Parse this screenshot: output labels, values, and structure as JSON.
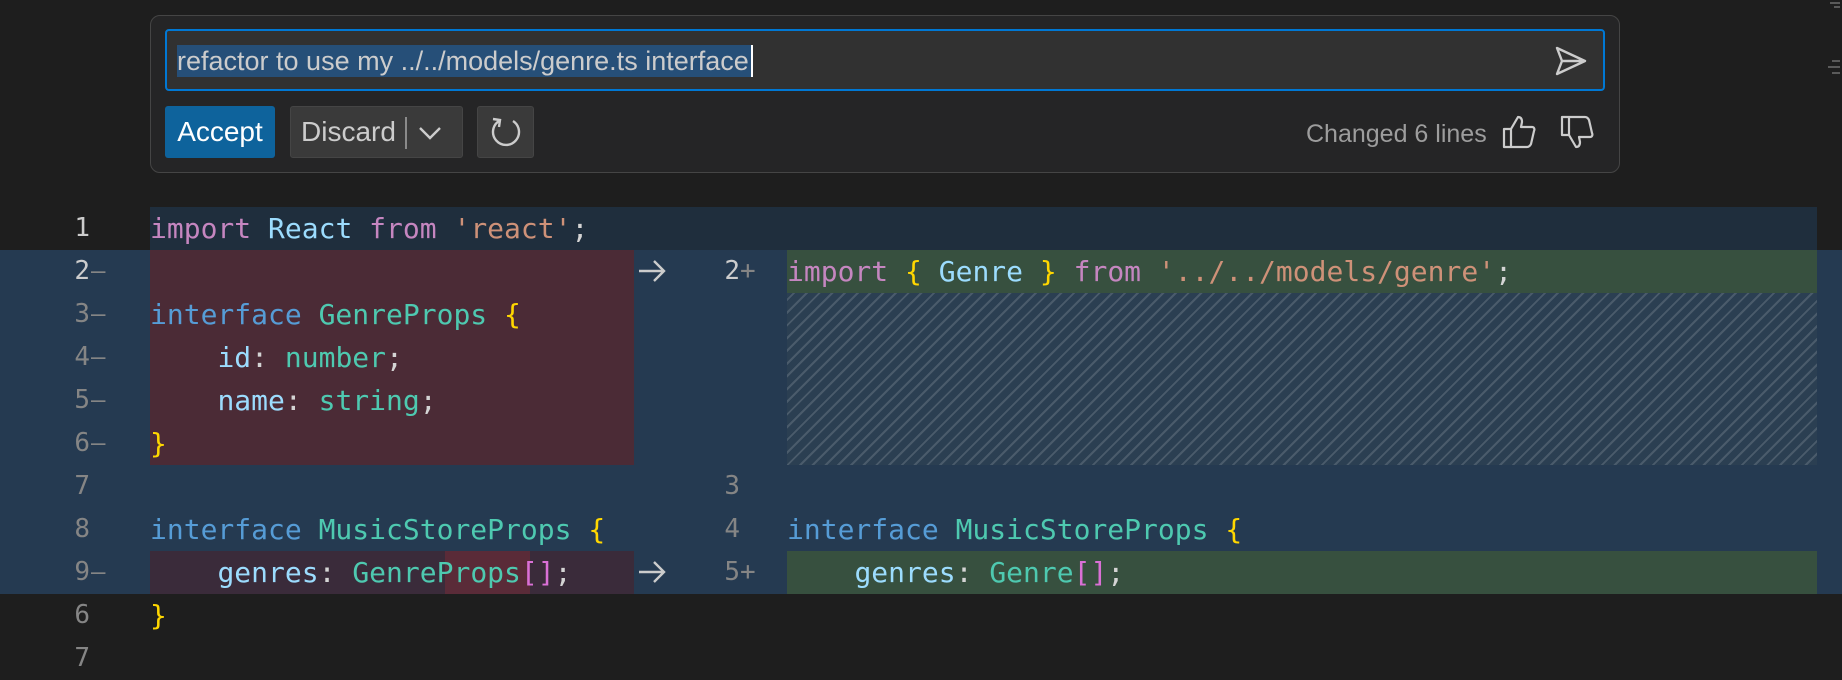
{
  "chat": {
    "prompt": "refactor to use my ../../models/genre.ts interface",
    "accept_label": "Accept",
    "discard_label": "Discard",
    "changed_text": "Changed 6 lines"
  },
  "icons": {
    "send": "send-icon",
    "chevron": "chevron-down-icon",
    "rerun": "refresh-icon",
    "thumbs_up": "thumbs-up-icon",
    "thumbs_down": "thumbs-down-icon",
    "arrow": "arrow-right-icon"
  },
  "colors": {
    "accent": "#0e639c",
    "deleted_bg": "#4b2b36",
    "inserted_bg": "#37503f",
    "diff_zone_bg": "#253a51"
  },
  "editor": {
    "line1": {
      "num": "1",
      "tokens": [
        "import",
        "React",
        "from",
        "'react'",
        ";"
      ]
    },
    "left": {
      "l2": {
        "num": "2",
        "mark": "—"
      },
      "l3": {
        "num": "3",
        "mark": "—",
        "kw": "interface",
        "name": "GenreProps",
        "brace": "{"
      },
      "l4": {
        "num": "4",
        "mark": "—",
        "prop": "id",
        "colon": ":",
        "type": "number",
        "semi": ";"
      },
      "l5": {
        "num": "5",
        "mark": "—",
        "prop": "name",
        "colon": ":",
        "type": "string",
        "semi": ";"
      },
      "l6": {
        "num": "6",
        "mark": "—",
        "brace": "}"
      },
      "l7": {
        "num": "7"
      },
      "l8": {
        "num": "8",
        "kw": "interface",
        "name": "MusicStoreProps",
        "brace": "{"
      },
      "l9": {
        "num": "9",
        "mark": "—",
        "prop": "genres",
        "colon": ":",
        "type": "GenreProps",
        "brk": "[]",
        "semi": ";"
      }
    },
    "right": {
      "r2": {
        "num": "2",
        "mark": "+",
        "kw": "import",
        "ob": "{",
        "name": "Genre",
        "cb": "}",
        "from": "from",
        "str": "'../../models/genre'",
        "semi": ";"
      },
      "r3": {
        "num": "3"
      },
      "r4": {
        "num": "4",
        "kw": "interface",
        "name": "MusicStoreProps",
        "brace": "{"
      },
      "r5": {
        "num": "5",
        "mark": "+",
        "prop": "genres",
        "colon": ":",
        "type": "Genre",
        "brk": "[]",
        "semi": ";"
      }
    },
    "line6": {
      "num": "6",
      "brace": "}"
    },
    "line7": {
      "num": "7"
    }
  }
}
